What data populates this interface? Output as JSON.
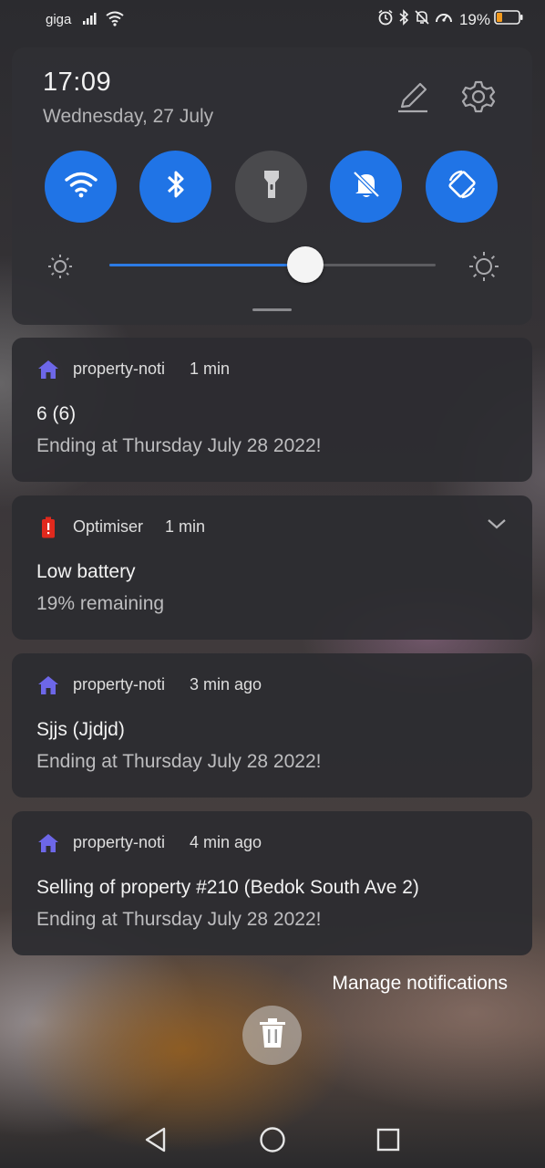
{
  "status_bar": {
    "carrier": "giga",
    "battery_percent_text": "19%",
    "icons": [
      "signal-icon",
      "wifi-icon",
      "alarm-icon",
      "bluetooth-icon",
      "mute-icon",
      "data-saver-icon",
      "battery-icon"
    ]
  },
  "quick_settings": {
    "time": "17:09",
    "date": "Wednesday, 27 July",
    "toggles": [
      {
        "name": "wifi",
        "icon": "wifi-icon",
        "on": true
      },
      {
        "name": "bluetooth",
        "icon": "bluetooth-icon",
        "on": true
      },
      {
        "name": "flashlight",
        "icon": "flashlight-icon",
        "on": false
      },
      {
        "name": "silent",
        "icon": "bell-off-icon",
        "on": true
      },
      {
        "name": "auto-rotate",
        "icon": "rotate-icon",
        "on": true
      }
    ],
    "brightness": 0.6
  },
  "notifications": [
    {
      "app": "property-noti",
      "time": "1 min",
      "title": "6 (6)",
      "body": "Ending at Thursday July 28 2022!",
      "icon": "home-icon"
    },
    {
      "app": "Optimiser",
      "time": "1 min",
      "title": "Low battery",
      "body": "19% remaining",
      "icon": "battery-alert-icon"
    },
    {
      "app": "property-noti",
      "time": "3 min ago",
      "title": "Sjjs (Jjdjd)",
      "body": "Ending at Thursday July 28 2022!",
      "icon": "home-icon"
    },
    {
      "app": "property-noti",
      "time": "4 min ago",
      "title": "Selling of property #210 (Bedok South Ave 2)",
      "body": "Ending at Thursday July 28 2022!",
      "icon": "home-icon"
    }
  ],
  "manage_notifications_label": "Manage notifications",
  "colors": {
    "accent": "#2074e6",
    "app_icon": "#6d67e8",
    "battery_alert": "#e0291d"
  }
}
